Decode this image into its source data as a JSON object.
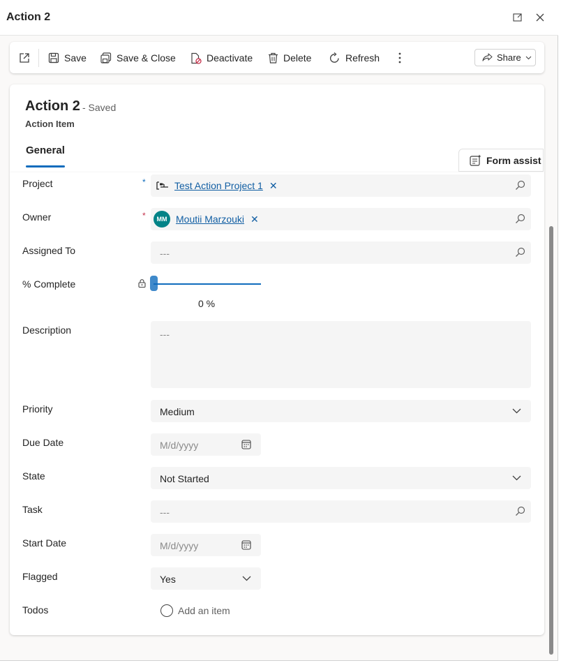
{
  "window": {
    "title": "Action 2",
    "popout_icon": "open-in-new-window-icon",
    "close_icon": "close-icon"
  },
  "toolbar": {
    "open_icon": "open-icon",
    "save_label": "Save",
    "save_close_label": "Save & Close",
    "deactivate_label": "Deactivate",
    "delete_label": "Delete",
    "refresh_label": "Refresh",
    "more_icon": "more-vertical-icon",
    "share_label": "Share"
  },
  "header": {
    "record_title": "Action 2",
    "status": "- Saved",
    "entity": "Action Item",
    "tabs": [
      {
        "label": "General",
        "selected": true
      }
    ],
    "form_assist_label": "Form assist"
  },
  "form": {
    "project": {
      "label": "Project",
      "required_marker": "*",
      "value": "Test Action Project 1"
    },
    "owner": {
      "label": "Owner",
      "required_marker": "*",
      "avatar_initials": "MM",
      "value": "Moutii Marzouki"
    },
    "assigned_to": {
      "label": "Assigned To",
      "placeholder": "---"
    },
    "percent_complete": {
      "label": "% Complete",
      "value": 0,
      "display": "0 %"
    },
    "description": {
      "label": "Description",
      "placeholder": "---"
    },
    "priority": {
      "label": "Priority",
      "value": "Medium"
    },
    "due_date": {
      "label": "Due Date",
      "placeholder": "M/d/yyyy"
    },
    "state": {
      "label": "State",
      "value": "Not Started"
    },
    "task": {
      "label": "Task",
      "placeholder": "---"
    },
    "start_date": {
      "label": "Start Date",
      "placeholder": "M/d/yyyy"
    },
    "flagged": {
      "label": "Flagged",
      "value": "Yes"
    },
    "todos": {
      "label": "Todos",
      "add_label": "Add an item"
    }
  },
  "colors": {
    "accent": "#0f6cbd",
    "avatar": "#038387",
    "required": "#c4314b"
  }
}
